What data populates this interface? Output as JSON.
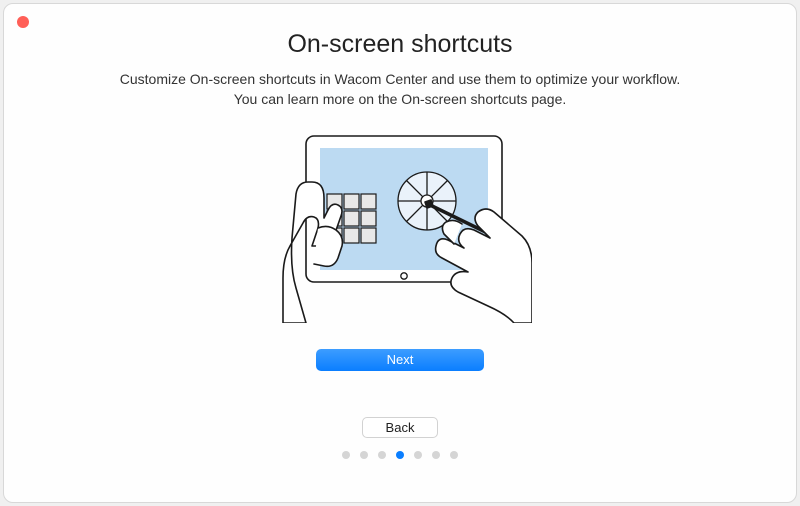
{
  "header": {
    "title": "On-screen shortcuts"
  },
  "body": {
    "description_line1": "Customize On-screen shortcuts in Wacom Center and use them to optimize your workflow.",
    "description_line2": "You can learn more on the On-screen shortcuts page."
  },
  "buttons": {
    "next": "Next",
    "back": "Back"
  },
  "pagination": {
    "total": 7,
    "active_index": 3
  }
}
